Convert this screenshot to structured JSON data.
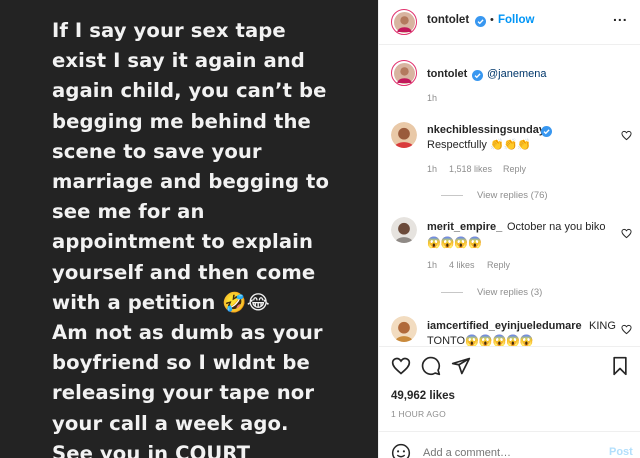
{
  "post_image": {
    "lines": [
      "If I say your sex tape",
      "exist I say it again and",
      "again child, you can’t be",
      "begging me behind the",
      "scene to save your",
      "marriage and begging to",
      "see me for an",
      "appointment to explain",
      "yourself and then come",
      "with a petition 🤣😂",
      "Am not as dumb as your",
      "boyfriend so I wldnt be",
      "releasing your tape nor",
      "your call a week ago.",
      "See you in COURT"
    ]
  },
  "header": {
    "username": "tontolet",
    "verified_icon": "verified-badge-icon",
    "separator": "•",
    "follow_label": "Follow",
    "more_label": "..."
  },
  "caption": {
    "username": "tontolet",
    "mention": "@janemena",
    "time": "1h"
  },
  "comments": [
    {
      "username": "nkechiblessingsunday",
      "verified": true,
      "text": "Respectfully 👏👏👏",
      "time": "1h",
      "likes": "1,518 likes",
      "reply": "Reply",
      "view_replies": "View replies (76)"
    },
    {
      "username": "merit_empire_",
      "verified": false,
      "text": "October na you biko",
      "text_line2": "😱😱😱😱",
      "time": "1h",
      "likes": "4 likes",
      "reply": "Reply",
      "view_replies": "View replies (3)"
    },
    {
      "username": "iamcertified_eyinjueledumare",
      "verified": false,
      "text": "KING",
      "text_line2": "TONTO😱😱😱😱😱"
    }
  ],
  "actions": {
    "likes": "49,962 likes",
    "timestamp": "1 HOUR AGO"
  },
  "add_comment": {
    "placeholder": "Add a comment…",
    "post_label": "Post"
  },
  "colors": {
    "link_blue": "#0095f6",
    "muted": "#8e8e8e",
    "text": "#262626",
    "image_bg": "#232323"
  }
}
